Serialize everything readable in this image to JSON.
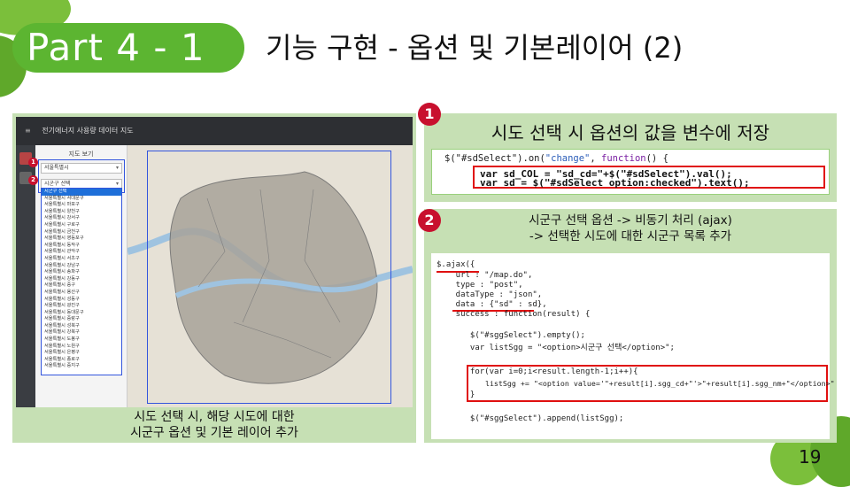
{
  "header": {
    "badge": "Part 4 - 1",
    "title": "기능 구현 - 옵션 및 기본레이어 (2)"
  },
  "left_panel": {
    "app": {
      "menu_glyph": "≡",
      "title": "전기에너지 사용량 데이터 지도",
      "panel_heading": "지도 보기",
      "sido_select": "서울특별시",
      "sgg_select": "시군구 선택",
      "markers": [
        "1",
        "2"
      ],
      "dropdown_items": [
        "시군구 선택",
        "서울특별시 서대문구",
        "서울특별시 마포구",
        "서울특별시 양천구",
        "서울특별시 강서구",
        "서울특별시 구로구",
        "서울특별시 금천구",
        "서울특별시 영등포구",
        "서울특별시 동작구",
        "서울특별시 관악구",
        "서울특별시 서초구",
        "서울특별시 강남구",
        "서울특별시 송파구",
        "서울특별시 강동구",
        "서울특별시 중구",
        "서울특별시 용산구",
        "서울특별시 성동구",
        "서울특별시 광진구",
        "서울특별시 동대문구",
        "서울특별시 중랑구",
        "서울특별시 성북구",
        "서울특별시 강북구",
        "서울특별시 도봉구",
        "서울특별시 노원구",
        "서울특별시 은평구",
        "서울특별시 종로구",
        "서울특별시 중지구"
      ]
    },
    "caption_line1": "시도 선택 시, 해당 시도에 대한",
    "caption_line2": "시군구 옵션 및 기본 레이어 추가"
  },
  "right_panel_1": {
    "number": "1",
    "title": "시도 선택 시 옵션의 값을 변수에 저장",
    "code_line1_a": "$(\"#sdSelect\").on(",
    "code_line1_b": "\"change\"",
    "code_line1_c": ", ",
    "code_line1_d": "function",
    "code_line1_e": "() {",
    "code_line2": "var sd_COL = \"sd_cd=\"+$(\"#sdSelect\").val();",
    "code_line3": "var sd = $(\"#sdSelect option:checked\").text();"
  },
  "right_panel_2": {
    "number": "2",
    "title_line1": "시군구 선택 옵션 -> 비동기 처리 (ajax)",
    "title_line2": "-> 선택한 시도에 대한 시군구 목록 추가",
    "code": [
      "$.ajax({",
      "    url : \"/map.do\",",
      "    type : \"post\",",
      "    dataType : \"json\",",
      "    data : {\"sd\" : sd},",
      "    success : function(result) {",
      "",
      "       $(\"#sggSelect\").empty();",
      "       var listSgg = \"<option>시군구 선택</option>\";",
      "",
      "       for(var i=0;i<result.length-1;i++){",
      "           listSgg += \"<option value='\"+result[i].sgg_cd+\"'>\"+result[i].sgg_nm+\"</option>\"",
      "       }",
      "",
      "       $(\"#sggSelect\").append(listSgg);"
    ]
  },
  "page_number": "19",
  "colors": {
    "badge_green": "#5cb531",
    "panel_green": "#c6e0b4",
    "marker_red": "#c8102e",
    "highlight_blue": "#3355dd"
  }
}
